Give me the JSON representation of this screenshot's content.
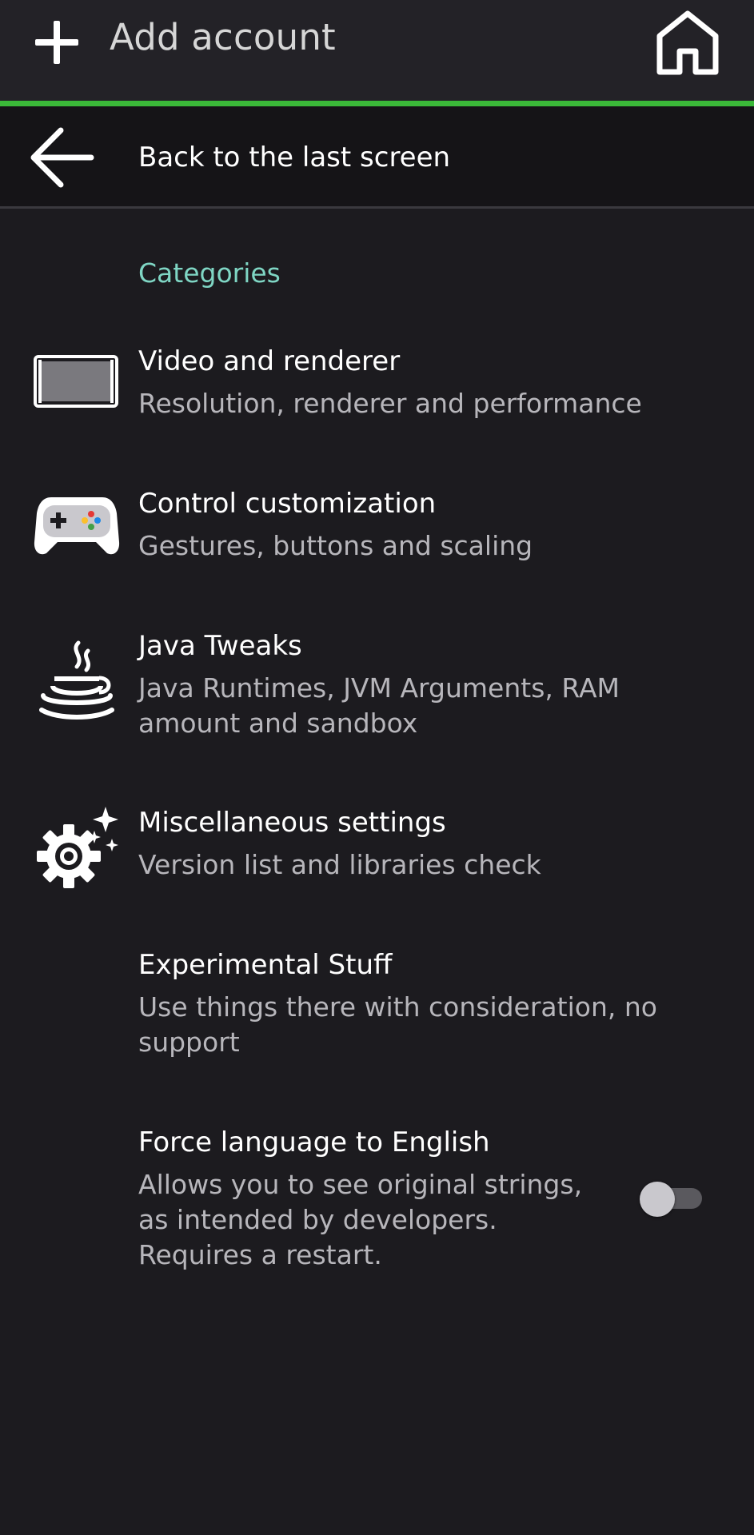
{
  "topbar": {
    "add_label": "Add account",
    "add_icon": "plus-icon",
    "home_icon": "home-icon",
    "accent_color": "#3bb939"
  },
  "back": {
    "label": "Back to the last screen",
    "icon": "arrow-back-icon"
  },
  "categories_header": "Categories",
  "items": [
    {
      "title": "Video and renderer",
      "summary": "Resolution, renderer and performance",
      "icon": "display-icon"
    },
    {
      "title": "Control customization",
      "summary": "Gestures, buttons and scaling",
      "icon": "gamepad-icon"
    },
    {
      "title": "Java Tweaks",
      "summary": "Java Runtimes, JVM Arguments, RAM amount and sandbox",
      "icon": "java-cup-icon"
    },
    {
      "title": "Miscellaneous settings",
      "summary": "Version list and libraries check",
      "icon": "gear-sparkle-icon"
    },
    {
      "title": "Experimental Stuff",
      "summary": "Use things there with consideration, no support",
      "icon": ""
    },
    {
      "title": "Force language to English",
      "summary": "Allows you to see original strings, as intended by developers. Requires a restart.",
      "icon": ""
    }
  ],
  "force_english_toggle": {
    "checked": false
  },
  "colors": {
    "background": "#1c1b1f",
    "topbar": "#232227",
    "category_header": "#7fd6c4",
    "summary_text": "#b7b6bb"
  }
}
